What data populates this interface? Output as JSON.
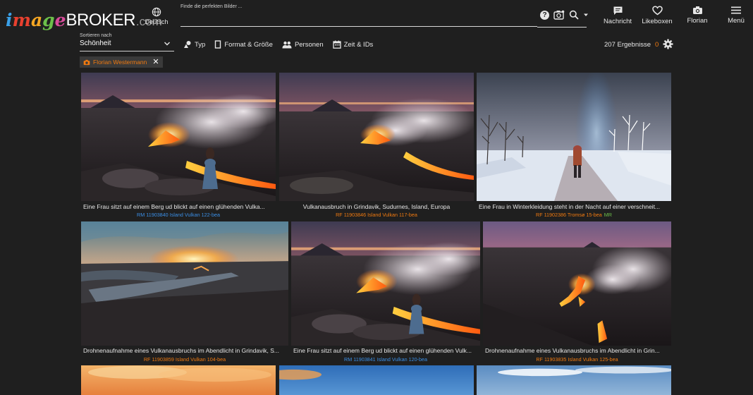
{
  "logo": {
    "image": [
      "i",
      "m",
      "a",
      "g",
      "e"
    ],
    "broker": "BROKER",
    "com": ".com"
  },
  "language": {
    "label": "Deutsch"
  },
  "search": {
    "hint": "Finde die perfekten Bilder ...",
    "value": "",
    "help": "?"
  },
  "nav": {
    "messages": "Nachricht",
    "likeboxes": "Likeboxen",
    "account": "Florian",
    "menu": "Menü"
  },
  "sort": {
    "caption": "Sortieren nach",
    "value": "Schönheit"
  },
  "filters": {
    "type": "Typ",
    "format": "Format & Größe",
    "people": "Personen",
    "time": "Zeit & IDs"
  },
  "results": {
    "count": "207 Ergebnisse",
    "zero": "0"
  },
  "chip": {
    "label": "Florian Westermann"
  },
  "images": [
    {
      "caption": "Eine Frau sitzt auf einem Berg ud blickt auf einen glühenden Vulka...",
      "license": "RM",
      "id": "11903840",
      "keywords": "Island Vulkan 122-bea",
      "mr": "",
      "scene": "volcano-woman"
    },
    {
      "caption": "Vulkanausbruch in Grindavik, Sudurnes, Island, Europa",
      "license": "RF",
      "id": "11903846",
      "keywords": "Island Vulkan 117-bea",
      "mr": "",
      "scene": "volcano"
    },
    {
      "caption": "Eine Frau in Winterkleidung steht in der Nacht auf einer verschneit...",
      "license": "RF",
      "id": "11902386",
      "keywords": "Tromsø 15-bea",
      "mr": "MR",
      "scene": "winter"
    },
    {
      "caption": "Drohnenaufnahme eines Vulkanausbruchs im Abendlicht in Grindavik, S...",
      "license": "RF",
      "id": "11903859",
      "keywords": "Island Vulkan 104-bea",
      "mr": "",
      "scene": "drone-sunset"
    },
    {
      "caption": "Eine Frau sitzt auf einem Berg ud blickt auf einen glühenden Vulk...",
      "license": "RM",
      "id": "11903841",
      "keywords": "Island Vulkan 120-bea",
      "mr": "",
      "scene": "volcano-woman2"
    },
    {
      "caption": "Drohnenaufnahme eines Vulkanausbruchs im Abendlicht in Grin...",
      "license": "RF",
      "id": "11903835",
      "keywords": "Island Vulkan 125-bea",
      "mr": "",
      "scene": "lava-flow"
    },
    {
      "caption": "",
      "license": "",
      "id": "",
      "keywords": "",
      "mr": "",
      "scene": "clouds-orange"
    },
    {
      "caption": "",
      "license": "",
      "id": "",
      "keywords": "",
      "mr": "",
      "scene": "sky-blue"
    },
    {
      "caption": "",
      "license": "",
      "id": "",
      "keywords": "",
      "mr": "",
      "scene": "sky-cloudy"
    }
  ],
  "colors": {
    "accent": "#f07a10",
    "rm": "#3b8fe6",
    "mr": "#6cc04a",
    "background": "#1f1f1f"
  }
}
